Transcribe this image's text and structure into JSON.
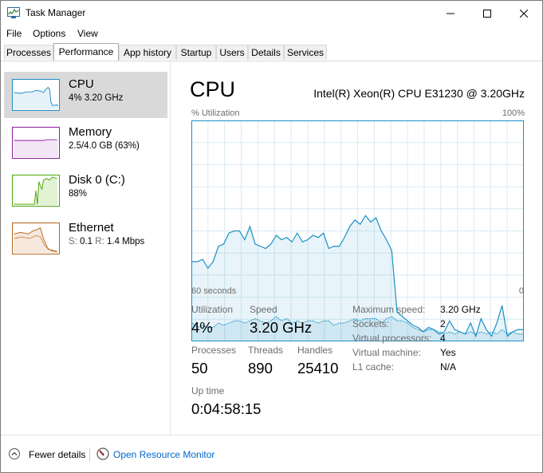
{
  "window": {
    "title": "Task Manager"
  },
  "menu": [
    "File",
    "Options",
    "View"
  ],
  "tabs": [
    "Processes",
    "Performance",
    "App history",
    "Startup",
    "Users",
    "Details",
    "Services"
  ],
  "sidebar": [
    {
      "name": "CPU",
      "sub": "4% 3.20 GHz",
      "color": "#1a8fc4"
    },
    {
      "name": "Memory",
      "sub": "2.5/4.0 GB (63%)",
      "color": "#8b1f9c"
    },
    {
      "name": "Disk 0 (C:)",
      "sub": "88%",
      "color": "#4da60c"
    },
    {
      "name": "Ethernet",
      "sub_s_label": "S:",
      "sub_s": "0.1",
      "sub_r_label": "R:",
      "sub_r": "1.4 Mbps",
      "color": "#b5651d"
    }
  ],
  "main": {
    "title": "CPU",
    "model": "Intel(R) Xeon(R) CPU E31230 @ 3.20GHz",
    "axis_top_left": "% Utilization",
    "axis_top_right": "100%",
    "axis_bottom_left": "60 seconds",
    "axis_bottom_right": "0"
  },
  "stats": {
    "utilization_label": "Utilization",
    "utilization": "4%",
    "speed_label": "Speed",
    "speed": "3.20 GHz",
    "processes_label": "Processes",
    "processes": "50",
    "threads_label": "Threads",
    "threads": "890",
    "handles_label": "Handles",
    "handles": "25410",
    "uptime_label": "Up time",
    "uptime": "0:04:58:15"
  },
  "specs": [
    {
      "label": "Maximum speed:",
      "value": "3.20 GHz"
    },
    {
      "label": "Sockets:",
      "value": "2"
    },
    {
      "label": "Virtual processors:",
      "value": "4"
    },
    {
      "label": "Virtual machine:",
      "value": "Yes"
    },
    {
      "label": "L1 cache:",
      "value": "N/A"
    }
  ],
  "footer": {
    "fewer_details": "Fewer details",
    "open_resource_monitor": "Open Resource Monitor"
  },
  "chart_data": {
    "type": "area",
    "ylim": [
      0,
      100
    ],
    "x_range_seconds": [
      60,
      0
    ],
    "series": [
      {
        "values": [
          36,
          36,
          37,
          33,
          36,
          43,
          44,
          49,
          50,
          50,
          46,
          52,
          44,
          43,
          42,
          44,
          48,
          46,
          47,
          45,
          49,
          45,
          46,
          48,
          47,
          49,
          42,
          43,
          43,
          47,
          52,
          55,
          53,
          57,
          54,
          56,
          50,
          46,
          41,
          13,
          11,
          9,
          7,
          6,
          4,
          6,
          5,
          3,
          4,
          9,
          5,
          4,
          3,
          8,
          2,
          10,
          5,
          2,
          8,
          16,
          2,
          4,
          5,
          5
        ]
      },
      {
        "values": [
          8,
          6,
          7,
          6,
          6,
          8,
          7,
          8,
          9,
          9,
          8,
          9,
          10,
          9,
          8,
          9,
          11,
          9,
          10,
          8,
          9,
          8,
          9,
          9,
          8,
          9,
          9,
          7,
          8,
          8,
          9,
          10,
          9,
          10,
          10,
          10,
          8,
          10,
          11,
          9,
          9,
          8,
          6,
          5,
          4,
          5,
          5,
          4,
          3,
          4,
          3,
          4,
          3,
          4,
          3,
          4,
          3,
          4,
          3,
          5,
          3,
          4,
          3,
          3
        ]
      }
    ]
  }
}
